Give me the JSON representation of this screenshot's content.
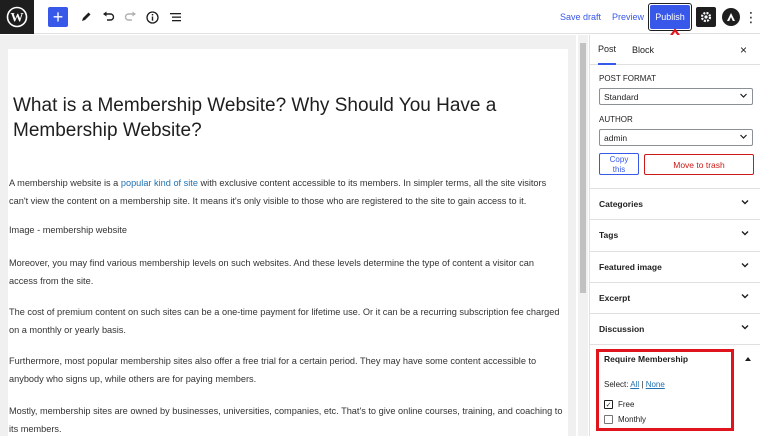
{
  "topbar": {
    "save_draft": "Save draft",
    "preview": "Preview",
    "publish": "Publish",
    "add": "+",
    "more": "⋮"
  },
  "post": {
    "title": "What is a Membership Website? Why Should You Have a Membership Website?",
    "paragraphs": [
      {
        "before": "A membership website is a ",
        "link": "popular kind of site",
        "after": " with exclusive content accessible to its members. In simpler terms, all the site visitors can't view the content on a membership site. It means it's only visible to those who are registered to the site to gain access to it."
      },
      {
        "text": "Image - membership website"
      },
      {
        "text": "Moreover, you may find various membership levels on such websites. And these levels determine the type of content a visitor can access from the site."
      },
      {
        "text": "The cost of premium content on such sites can be a one-time payment for lifetime use. Or it can be a recurring subscription fee charged on a monthly or yearly basis."
      },
      {
        "text": "Furthermore, most popular membership sites also offer a free trial for a certain period. They may have some content accessible to anybody who signs up, while others are for paying members."
      },
      {
        "text": "Mostly, membership sites are owned by businesses, universities, companies, etc. That's to give online courses, training, and coaching to its members."
      }
    ]
  },
  "sidebar": {
    "tab_post": "Post",
    "tab_block": "Block",
    "close": "×",
    "post_format_label": "POST FORMAT",
    "post_format_value": "Standard",
    "author_label": "AUTHOR",
    "author_value": "admin",
    "copy_line1": "Copy",
    "copy_line2": "this",
    "trash": "Move to trash",
    "panels": [
      "Categories",
      "Tags",
      "Featured image",
      "Excerpt",
      "Discussion"
    ],
    "membership": {
      "title": "Require Membership",
      "select_label": "Select:",
      "all": "All",
      "sep": "|",
      "none": "None",
      "options": [
        {
          "label": "Free",
          "checked": true
        },
        {
          "label": "Monthly",
          "checked": false
        }
      ]
    }
  },
  "colors": {
    "accent": "#3858e9",
    "danger": "#cc1818",
    "annotation": "#e0141c",
    "link": "#2271b1"
  },
  "icons": [
    "wordpress-icon",
    "pen-icon",
    "undo-icon",
    "redo-icon",
    "info-icon",
    "list-view-icon",
    "gear-icon",
    "astra-icon",
    "chevron-down-icon",
    "close-icon"
  ]
}
